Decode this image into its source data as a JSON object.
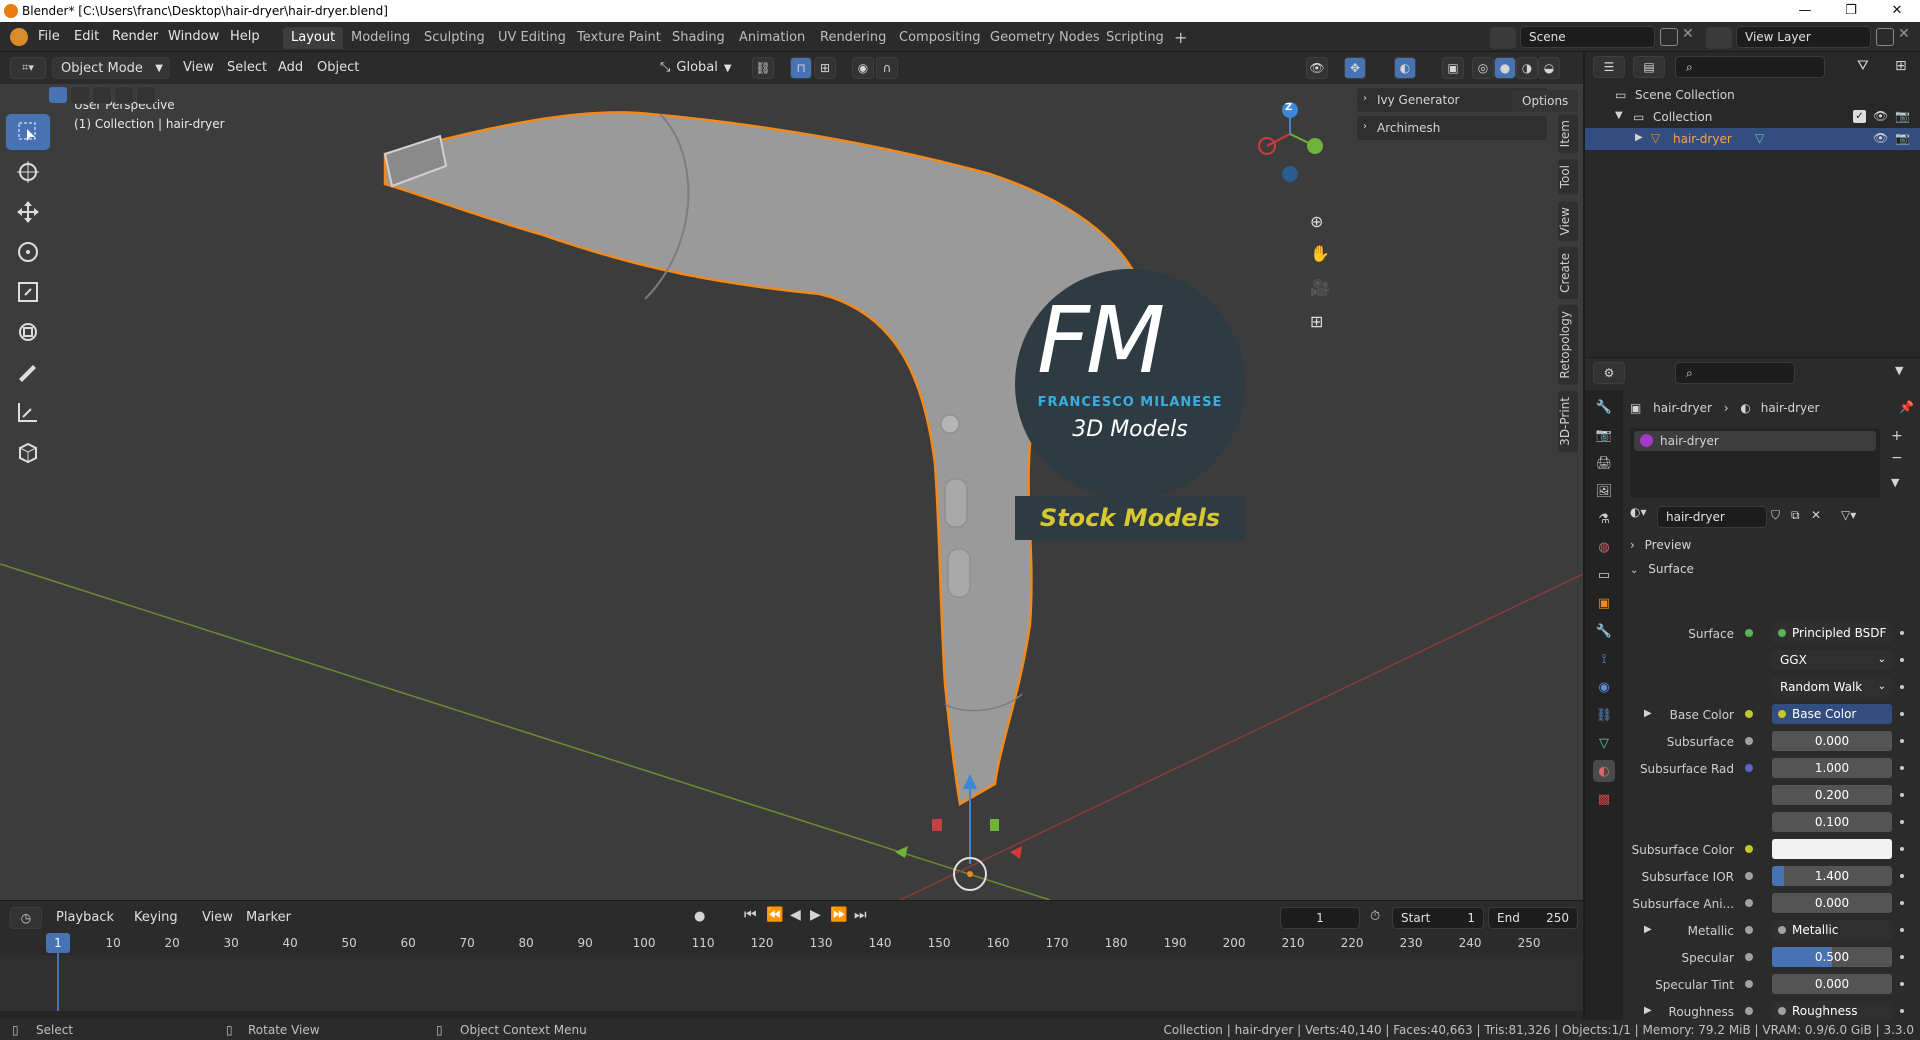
{
  "window": {
    "title": "Blender* [C:\\Users\\franc\\Desktop\\hair-dryer\\hair-dryer.blend]",
    "minimize": "—",
    "maximize": "❐",
    "close": "✕"
  },
  "menu": [
    "File",
    "Edit",
    "Render",
    "Window",
    "Help"
  ],
  "workspaces": [
    "Layout",
    "Modeling",
    "Sculpting",
    "UV Editing",
    "Texture Paint",
    "Shading",
    "Animation",
    "Rendering",
    "Compositing",
    "Geometry Nodes",
    "Scripting"
  ],
  "workspace_add": "+",
  "scene": {
    "name": "Scene",
    "view_layer": "View Layer"
  },
  "viewport_header": {
    "mode": "Object Mode",
    "menus": [
      "View",
      "Select",
      "Add",
      "Object"
    ],
    "transform": "Global",
    "options": "Options"
  },
  "viewport": {
    "perspective": "User Perspective",
    "collection_info": "(1) Collection | hair-dryer",
    "panels": [
      "Ivy Generator",
      "Archimesh"
    ],
    "side_tabs": [
      "Item",
      "Tool",
      "View",
      "Create",
      "Retopology",
      "3D-Print"
    ],
    "gizmo_axes": [
      "Z",
      "X",
      "Y"
    ],
    "overlay_logo": {
      "letters": "FM",
      "name": "FRANCESCO MILANESE",
      "subtitle": "3D Models",
      "banner": "Stock Models"
    }
  },
  "timeline": {
    "menus": [
      "Playback",
      "Keying",
      "View",
      "Marker"
    ],
    "current_frame": "1",
    "start_label": "Start",
    "start": "1",
    "end_label": "End",
    "end": "250",
    "ticks": [
      "1",
      "10",
      "20",
      "30",
      "40",
      "50",
      "60",
      "70",
      "80",
      "90",
      "100",
      "110",
      "120",
      "130",
      "140",
      "150",
      "160",
      "170",
      "180",
      "190",
      "200",
      "210",
      "220",
      "230",
      "240",
      "250"
    ]
  },
  "status": {
    "select": "Select",
    "rotate": "Rotate View",
    "context": "Object Context Menu",
    "stats": "Collection | hair-dryer | Verts:40,140 | Faces:40,663 | Tris:81,326 | Objects:1/1 | Memory: 79.2 MiB | VRAM: 0.9/6.0 GiB | 3.3.0"
  },
  "outliner": {
    "items": [
      {
        "label": "Scene Collection",
        "level": 0
      },
      {
        "label": "Collection",
        "level": 1
      },
      {
        "label": "hair-dryer",
        "level": 2,
        "selected": true
      }
    ]
  },
  "properties": {
    "breadcrumb": [
      "hair-dryer",
      "hair-dryer"
    ],
    "material_slot": "hair-dryer",
    "material_name": "hair-dryer",
    "sections": {
      "preview": "Preview",
      "surface": "Surface"
    },
    "rows": [
      {
        "label": "Surface",
        "value": "Principled BSDF",
        "dot": "#5ab55a",
        "kind": "link"
      },
      {
        "label": "",
        "value": "GGX",
        "kind": "dropdown"
      },
      {
        "label": "",
        "value": "Random Walk",
        "kind": "dropdown"
      },
      {
        "label": "Base Color",
        "value": "Base Color",
        "dot": "#c7c729",
        "kind": "link",
        "expand": true
      },
      {
        "label": "Subsurface",
        "value": "0.000",
        "dot": "#a1a1a1",
        "kind": "num"
      },
      {
        "label": "Subsurface Rad",
        "value": "1.000",
        "dot": "#6363c7",
        "kind": "num"
      },
      {
        "label": "",
        "value": "0.200",
        "kind": "num"
      },
      {
        "label": "",
        "value": "0.100",
        "kind": "num"
      },
      {
        "label": "Subsurface Color",
        "value": "",
        "dot": "#c7c729",
        "kind": "color"
      },
      {
        "label": "Subsurface IOR",
        "value": "1.400",
        "dot": "#a1a1a1",
        "kind": "num",
        "fill": 0.1
      },
      {
        "label": "Subsurface Ani...",
        "value": "0.000",
        "dot": "#a1a1a1",
        "kind": "num"
      },
      {
        "label": "Metallic",
        "value": "Metallic",
        "dot": "#a1a1a1",
        "kind": "link",
        "expand": true
      },
      {
        "label": "Specular",
        "value": "0.500",
        "dot": "#a1a1a1",
        "kind": "num",
        "fill": 0.5
      },
      {
        "label": "Specular Tint",
        "value": "0.000",
        "dot": "#a1a1a1",
        "kind": "num"
      },
      {
        "label": "Roughness",
        "value": "Roughness",
        "dot": "#a1a1a1",
        "kind": "link",
        "expand": true
      }
    ]
  }
}
